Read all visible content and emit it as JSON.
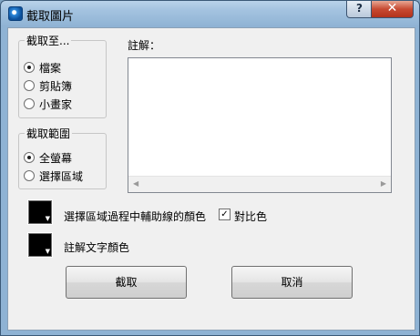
{
  "window": {
    "title": "截取圖片",
    "help_glyph": "?",
    "close_glyph": "✕"
  },
  "capture_to": {
    "title": "截取至...",
    "options": [
      {
        "label": "檔案",
        "checked": true
      },
      {
        "label": "剪貼簿",
        "checked": false
      },
      {
        "label": "小畫家",
        "checked": false
      }
    ]
  },
  "capture_range": {
    "title": "截取範圍",
    "options": [
      {
        "label": "全螢幕",
        "checked": true
      },
      {
        "label": "選擇區域",
        "checked": false
      }
    ]
  },
  "note": {
    "label": "註解：",
    "value": ""
  },
  "guide_color": {
    "label": "選擇區域過程中輔助線的顏色",
    "color": "#000000"
  },
  "contrast": {
    "label": "對比色",
    "checked": true,
    "check_glyph": "✓"
  },
  "note_text_color": {
    "label": "註解文字顏色",
    "color": "#000000"
  },
  "buttons": {
    "capture": "截取",
    "cancel": "取消"
  }
}
